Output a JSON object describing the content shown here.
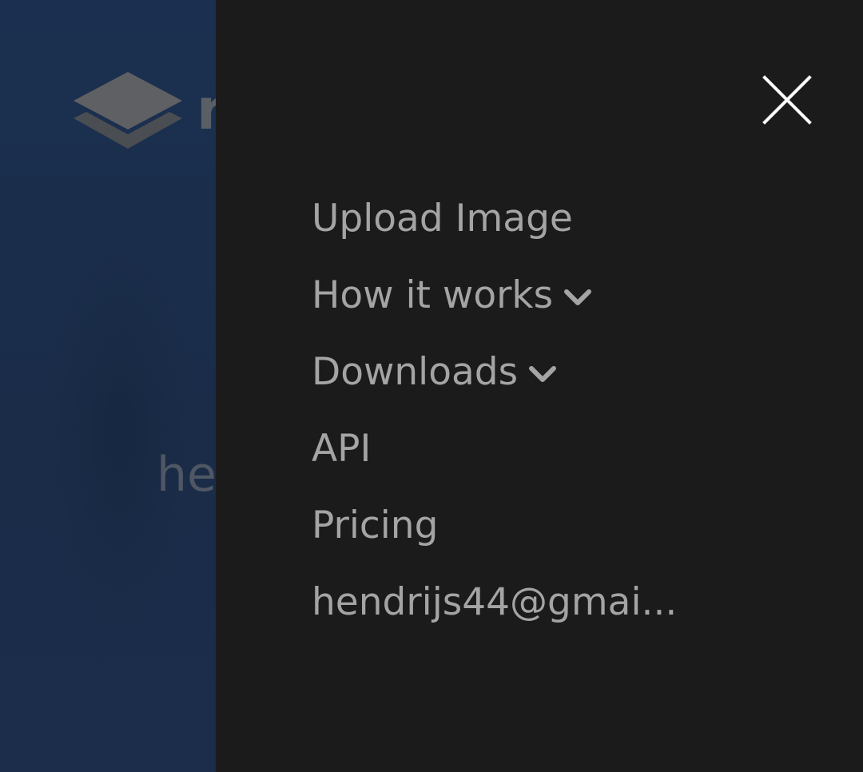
{
  "background": {
    "hero_text": "he",
    "logo_letter": "r"
  },
  "drawer": {
    "close_label": "Close menu",
    "menu": [
      {
        "label": "Upload Image",
        "has_dropdown": false
      },
      {
        "label": "How it works",
        "has_dropdown": true,
        "icon": "chevron-down-icon"
      },
      {
        "label": "Downloads",
        "has_dropdown": true,
        "icon": "chevron-down-icon"
      },
      {
        "label": "API",
        "has_dropdown": false
      },
      {
        "label": "Pricing",
        "has_dropdown": false
      },
      {
        "label": "hendrijs44@gmai...",
        "has_dropdown": false
      }
    ]
  },
  "colors": {
    "drawer_bg": "#1b1b1b",
    "menu_text": "#a4a4a4",
    "close_icon": "#ffffff",
    "background_page": "#1b3050"
  }
}
